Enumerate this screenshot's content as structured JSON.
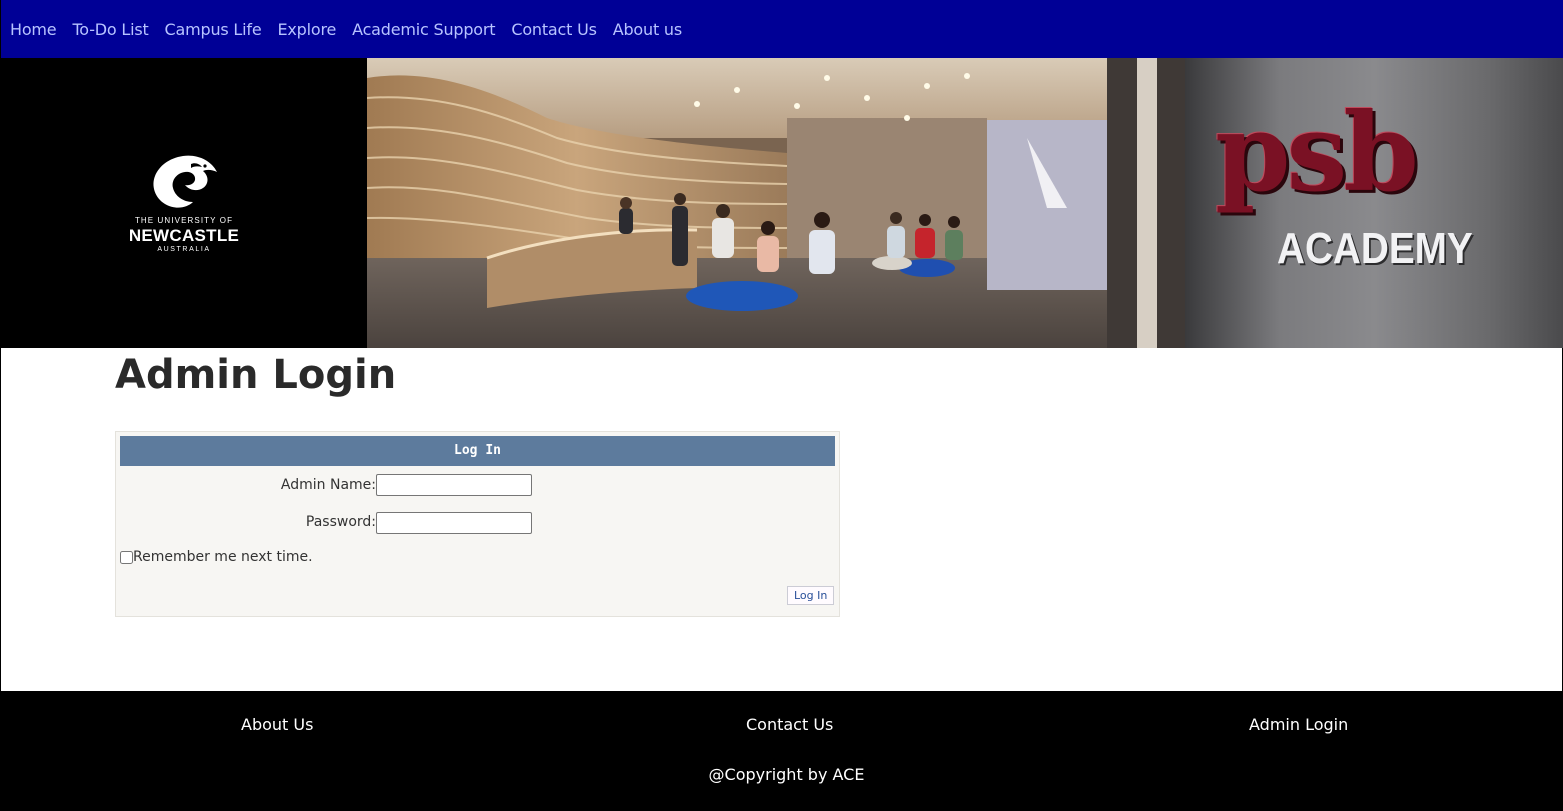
{
  "nav": {
    "items": [
      {
        "label": "Home"
      },
      {
        "label": "To-Do List"
      },
      {
        "label": "Campus Life"
      },
      {
        "label": "Explore"
      },
      {
        "label": "Academic Support"
      },
      {
        "label": "Contact Us"
      },
      {
        "label": "About us"
      }
    ]
  },
  "banner": {
    "uon_logo": {
      "line1": "THE UNIVERSITY OF",
      "line2": "NEWCASTLE",
      "line3": "AUSTRALIA"
    },
    "psb_logo": {
      "main": "psb",
      "sub": "ACADEMY"
    }
  },
  "main": {
    "title": "Admin Login",
    "login": {
      "header": "Log In",
      "admin_name_label": "Admin Name:",
      "admin_name_value": "",
      "password_label": "Password:",
      "password_value": "",
      "remember_label": "Remember me next time.",
      "remember_checked": false,
      "submit_label": "Log In"
    }
  },
  "footer": {
    "about_label": "About Us",
    "contact_label": "Contact Us",
    "admin_label": "Admin Login",
    "copyright": "@Copyright by ACE"
  },
  "colors": {
    "nav_bg": "#000096",
    "nav_text": "#b7c3ff",
    "login_header_bg": "#5d7b9d",
    "login_box_bg": "#f7f6f3",
    "psb_red": "#7a1124",
    "footer_bg": "#000000"
  }
}
